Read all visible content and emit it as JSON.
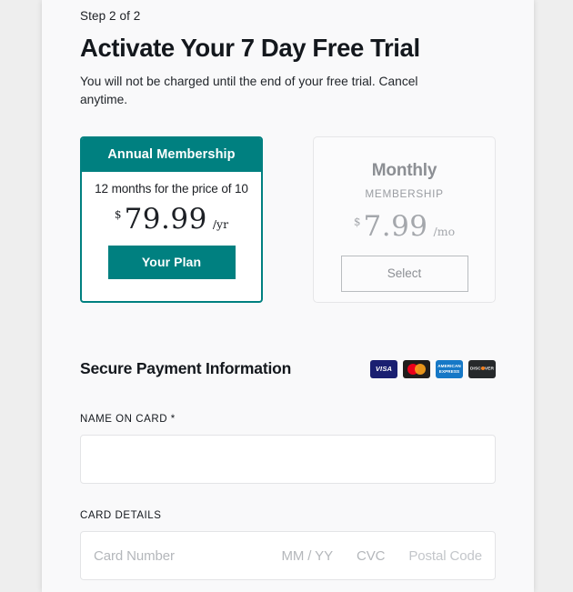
{
  "header": {
    "step": "Step 2 of 2",
    "title": "Activate Your 7 Day Free Trial",
    "subtitle": "You will not be charged until the end of your free trial. Cancel anytime."
  },
  "plans": {
    "annual": {
      "header": "Annual Membership",
      "tagline": "12 months for the price of 10",
      "currency": "$",
      "amount": "79.99",
      "period": "/yr",
      "button_label": "Your Plan",
      "selected": true,
      "accent_color": "#008080"
    },
    "monthly": {
      "title": "Monthly",
      "subtitle": "MEMBERSHIP",
      "currency": "$",
      "amount": "7.99",
      "period": "/mo",
      "button_label": "Select",
      "selected": false,
      "muted_color": "#8c8f94"
    }
  },
  "payment": {
    "section_title": "Secure Payment Information",
    "card_brands": [
      {
        "name": "visa-card-icon",
        "label": "VISA"
      },
      {
        "name": "mastercard-card-icon",
        "label": ""
      },
      {
        "name": "amex-card-icon",
        "label": "AMERICAN\nEXPRESS"
      },
      {
        "name": "discover-card-icon",
        "label": "DISC VER"
      }
    ],
    "name_on_card": {
      "label": "NAME ON CARD *",
      "value": "",
      "placeholder": ""
    },
    "card_details": {
      "label": "CARD DETAILS",
      "number_placeholder": "Card Number",
      "expiry_placeholder": "MM / YY",
      "cvc_placeholder": "CVC",
      "postal_placeholder": "Postal Code"
    }
  }
}
